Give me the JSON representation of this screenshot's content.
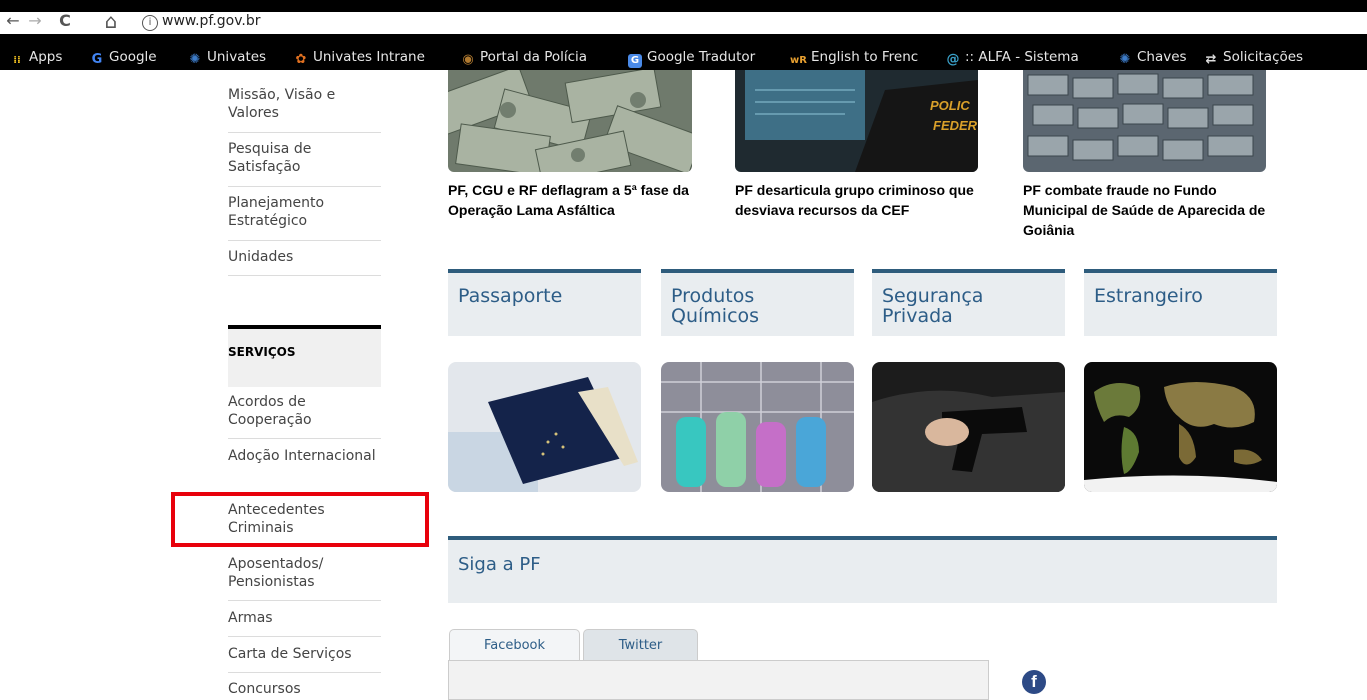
{
  "browser": {
    "url": "www.pf.gov.br",
    "info_glyph": "i",
    "back_glyph": "←",
    "forward_glyph": "→",
    "reload_glyph": "C",
    "home_glyph": "⌂",
    "bookmarks": [
      {
        "label": "Apps",
        "icon": "apps-grid-icon",
        "color": "#f0c020",
        "glyph": "⁞⁞"
      },
      {
        "label": "Google",
        "icon": "google-icon",
        "color": "#4285f4",
        "glyph": "G"
      },
      {
        "label": "Univates",
        "icon": "univates-icon",
        "color": "#3d7cc9",
        "glyph": "✺"
      },
      {
        "label": "Univates Intrane",
        "icon": "intranet-icon",
        "color": "#e07020",
        "glyph": "✿"
      },
      {
        "label": "Portal da Polícia",
        "icon": "police-badge-icon",
        "color": "#b07a30",
        "glyph": "◉"
      },
      {
        "label": "Google Tradutor",
        "icon": "translate-icon",
        "color": "#4a8ae8",
        "glyph": "G"
      },
      {
        "label": "English to Frenc",
        "icon": "wordreference-icon",
        "color": "#1f4fa0",
        "glyph": "wR"
      },
      {
        "label": ":: ALFA - Sistema",
        "icon": "alfa-icon",
        "color": "#3aa0c8",
        "glyph": "@"
      },
      {
        "label": "Chaves",
        "icon": "chaves-icon",
        "color": "#3d7cc9",
        "glyph": "✺"
      },
      {
        "label": "Solicitações",
        "icon": "exchange-icon",
        "color": "#dddddd",
        "glyph": "⇄"
      }
    ]
  },
  "sidebar": {
    "top_items": [
      "Missão, Visão e Valores",
      "Pesquisa de Satisfação",
      "Planejamento Estratégico",
      "Unidades"
    ],
    "heading": "SERVIÇOS",
    "service_items": [
      "Acordos de Cooperação",
      "Adoção Internacional",
      "Antecedentes Criminais",
      "Aposentados/ Pensionistas",
      "Armas",
      "Carta de Serviços",
      "Concursos"
    ]
  },
  "news": [
    {
      "title": "PF, CGU e RF deflagram a 5ª fase da Operação Lama Asfáltica",
      "image": "money-stacks-photo"
    },
    {
      "title": "PF desarticula grupo criminoso que desviava recursos da CEF",
      "image": "federal-police-agent-photo"
    },
    {
      "title": "PF combate fraude no Fundo Municipal de Saúde de Aparecida de Goiânia",
      "image": "seized-cash-photo"
    }
  ],
  "services": [
    {
      "label": "Passaporte",
      "image": "passport-photo"
    },
    {
      "label": "Produtos Químicos",
      "image": "test-tubes-photo"
    },
    {
      "label": "Segurança Privada",
      "image": "holstered-gun-photo"
    },
    {
      "label": "Estrangeiro",
      "image": "world-map-photo"
    }
  ],
  "social": {
    "heading": "Siga a PF",
    "tabs": [
      "Facebook",
      "Twitter"
    ],
    "facebook_glyph": "f"
  }
}
